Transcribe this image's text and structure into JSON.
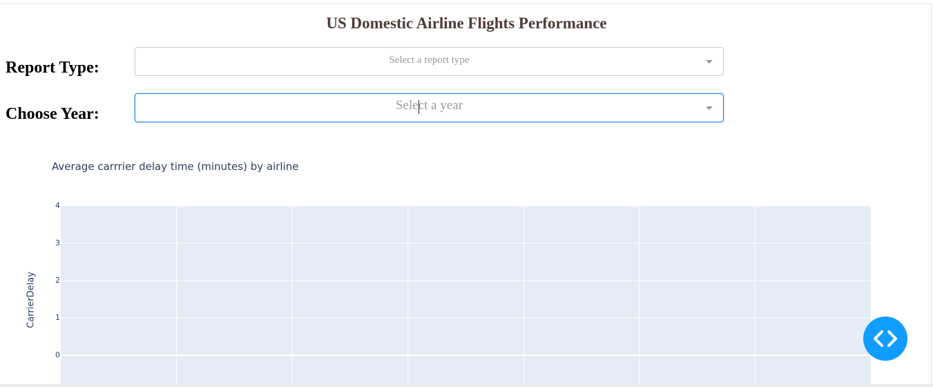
{
  "header": {
    "title": "US Domestic Airline Flights Performance"
  },
  "filters": {
    "report_type": {
      "label": "Report Type:",
      "placeholder": "Select a report type"
    },
    "year": {
      "label": "Choose Year:",
      "placeholder": "Select a year"
    }
  },
  "chart_data": {
    "type": "bar",
    "title": "Average carrrier delay time (minutes) by airline",
    "xlabel": "",
    "ylabel": "CarrierDelay",
    "ylim": [
      -0.7,
      4
    ],
    "yticks": [
      "4",
      "3",
      "2",
      "1",
      "0"
    ],
    "categories": [],
    "values": [],
    "grid": true,
    "plot_bg": "#e5ecf6"
  },
  "dev_tools": {
    "icon": "code-icon",
    "color": "#119dff"
  }
}
